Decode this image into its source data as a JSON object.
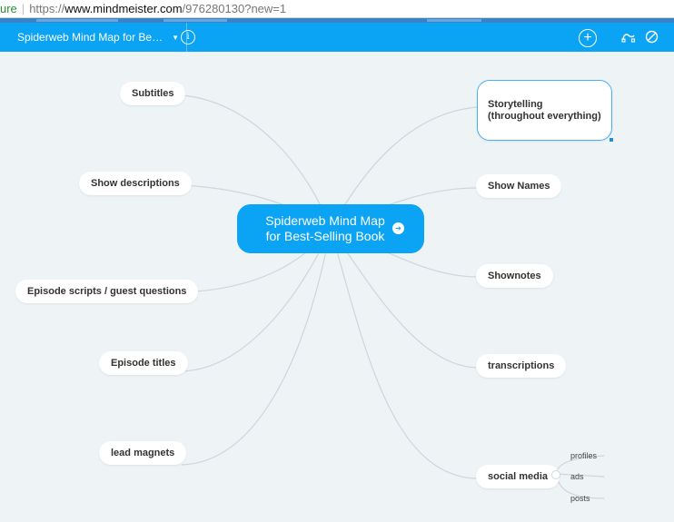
{
  "browser": {
    "secure_label": "ure",
    "url_protocol": "https://",
    "url_host": "www.mindmeister.com",
    "url_path": "/976280130?new=1"
  },
  "toolbar": {
    "map_title": "Spiderweb Mind Map for Be…",
    "info_label": "i",
    "add_label": "+",
    "icons": [
      "caret-down-icon",
      "info-icon",
      "add-icon",
      "branch-style-icon",
      "disable-icon"
    ]
  },
  "map": {
    "central_topic": "Spiderweb Mind Map for Best-Selling Book",
    "left_topics": [
      "Subtitles",
      "Show descriptions",
      "Episode scripts / guest questions",
      "Episode titles",
      "lead magnets"
    ],
    "right_topics": [
      "Storytelling\n(throughout everything)",
      "Show Names",
      "Shownotes",
      "transcriptions",
      "social media"
    ],
    "social_media_subtopics": [
      "profiles",
      "ads",
      "posts"
    ],
    "colors": {
      "accent": "#0ba3f3",
      "canvas": "#eef3f6",
      "connector": "#cdd6dc",
      "node": "#ffffff",
      "selected_border": "#4aaef2"
    }
  }
}
